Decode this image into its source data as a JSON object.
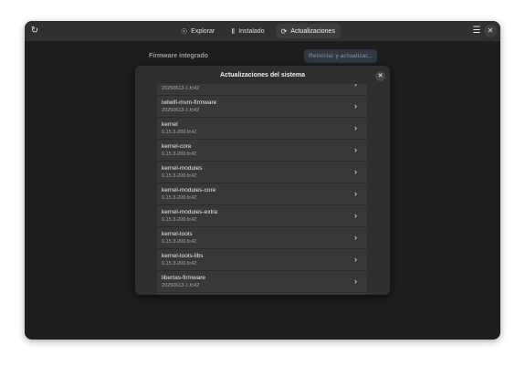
{
  "header": {
    "refresh_icon": "refresh-icon",
    "tabs": [
      {
        "label": "Explorar",
        "icon": "compass-icon"
      },
      {
        "label": "Instalado",
        "icon": "library-icon"
      },
      {
        "label": "Actualizaciones",
        "icon": "sync-icon"
      }
    ],
    "menu_icon": "hamburger-menu-icon",
    "close_icon": "close-icon"
  },
  "page": {
    "section_label": "Firmware integrado",
    "restart_label": "Reiniciar y actualizar..."
  },
  "dialog": {
    "title": "Actualizaciones del sistema",
    "close_icon": "close-icon",
    "packages": [
      {
        "name": "",
        "version": "20250613-1.fc42"
      },
      {
        "name": "iwlwifi-mvm-firmware",
        "version": "20250613-1.fc42"
      },
      {
        "name": "kernel",
        "version": "6.15.3-200.fc42"
      },
      {
        "name": "kernel-core",
        "version": "6.15.3-200.fc42"
      },
      {
        "name": "kernel-modules",
        "version": "6.15.3-200.fc42"
      },
      {
        "name": "kernel-modules-core",
        "version": "6.15.3-200.fc42"
      },
      {
        "name": "kernel-modules-extra",
        "version": "6.15.3-200.fc42"
      },
      {
        "name": "kernel-tools",
        "version": "6.15.3-200.fc42"
      },
      {
        "name": "kernel-tools-libs",
        "version": "6.15.3-200.fc42"
      },
      {
        "name": "libertas-firmware",
        "version": "20250613-1.fc42"
      }
    ]
  },
  "colors": {
    "window_bg": "#242424",
    "headerbar_bg": "#303030",
    "dialog_bg": "#2e2e2e",
    "list_bg": "#383838",
    "restart_button_bg": "#3b4552"
  }
}
